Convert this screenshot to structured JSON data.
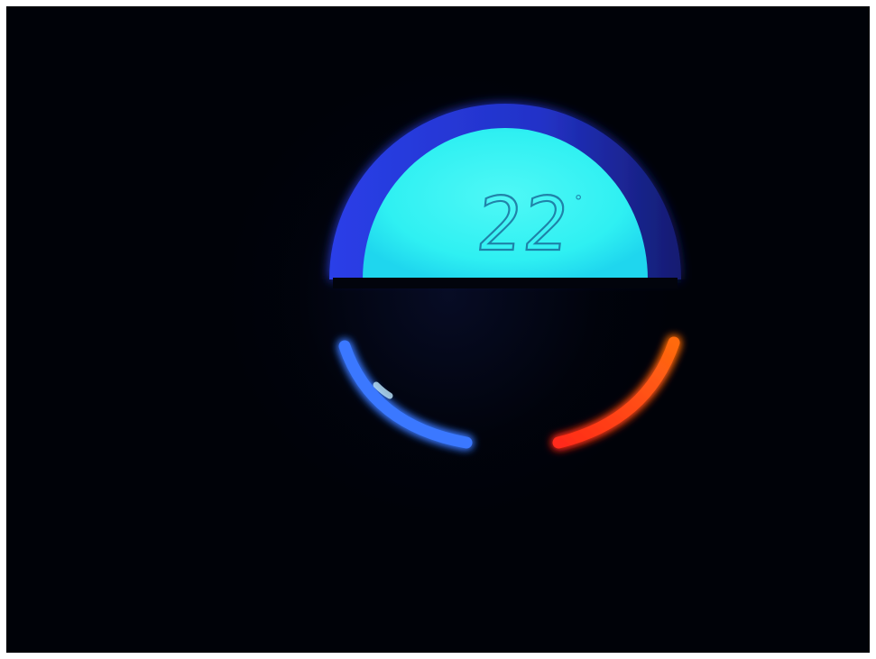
{
  "display": {
    "temperature_value": "22",
    "temperature_unit": "°"
  },
  "dial": {
    "cold_indicator_color": "#3a7bff",
    "hot_indicator_color": "#ff3a10",
    "screen_color": "#35f0f0",
    "bezel_color": "#2a3ae0"
  }
}
